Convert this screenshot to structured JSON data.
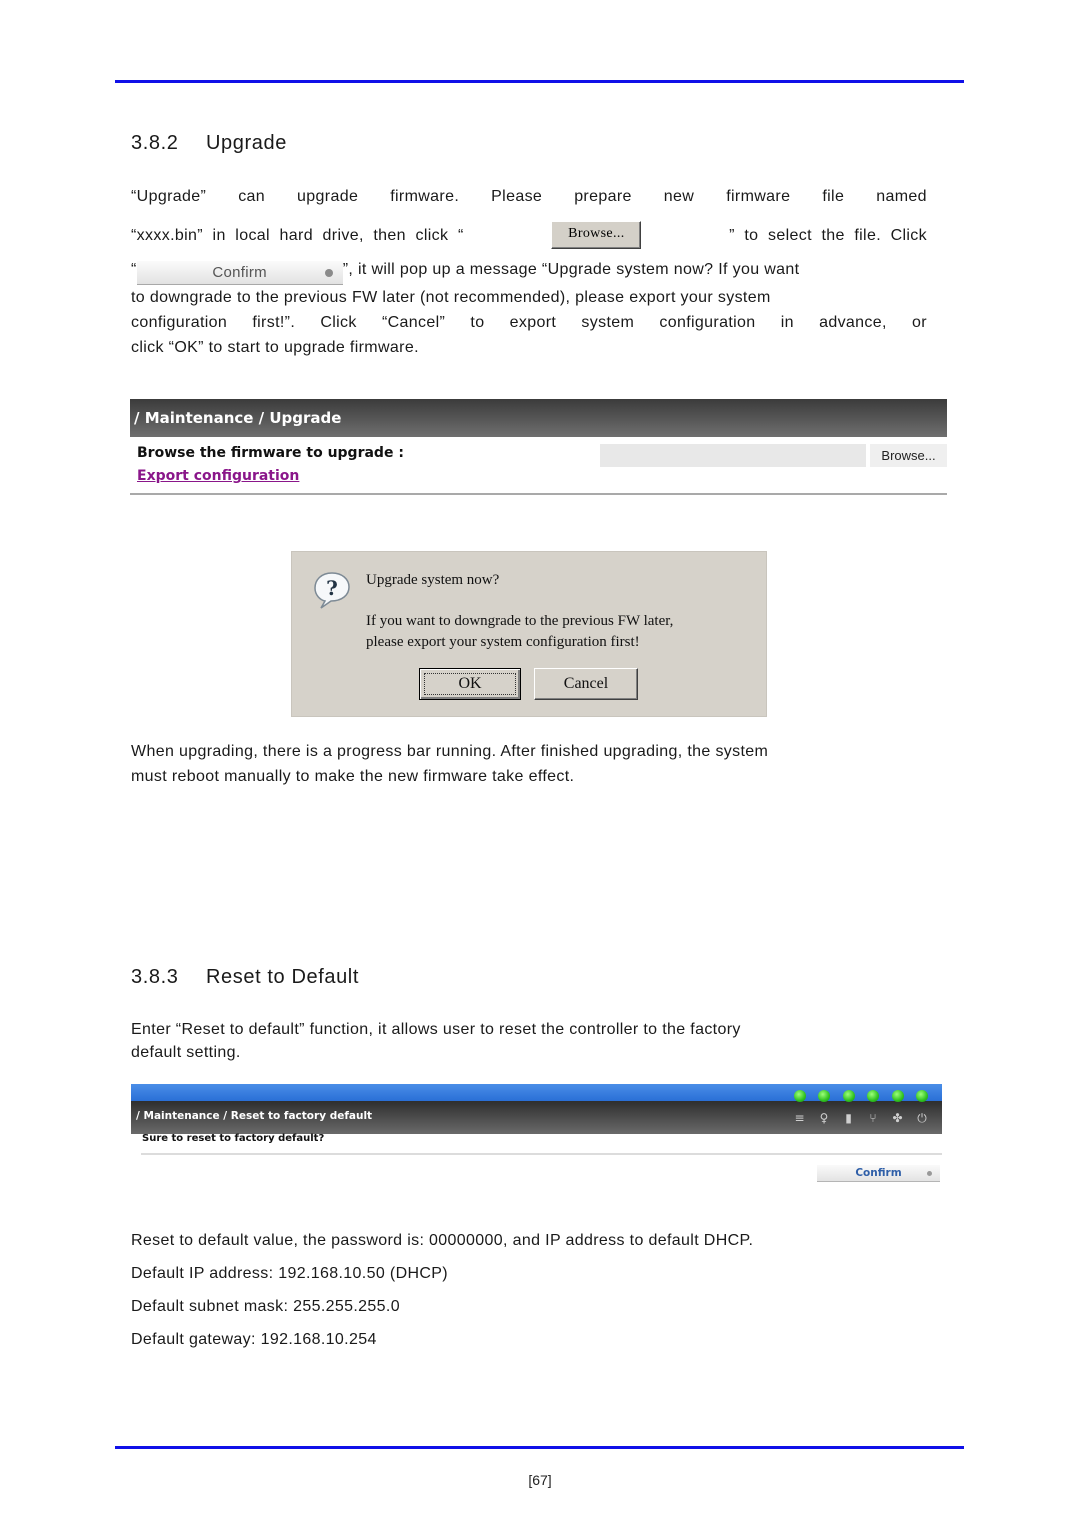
{
  "page": {
    "number": "[67]",
    "rule_color": "#1010e8"
  },
  "upgrade_section": {
    "number": "3.8.2",
    "title": "Upgrade",
    "intro": {
      "line1_words": [
        "“Upgrade”",
        "can",
        "upgrade",
        "firmware.",
        "Please",
        "prepare",
        "new",
        "firmware",
        "file",
        "named"
      ],
      "line2_before": "“xxxx.bin”  in  local  hard  drive,  then  click  “",
      "browse_label": "Browse...",
      "line2_after": "”  to  select  the  file.  Click",
      "line3_before": "“",
      "confirm_label": "Confirm",
      "line3_after": "”, it will pop up a message “Upgrade system now? If you want",
      "line4": "to downgrade to the previous FW later (not recommended), please export your system",
      "line5_words": [
        "configuration",
        "first!”.",
        "Click",
        "“Cancel”",
        "to",
        "export",
        "system",
        "configuration",
        "in",
        "advance,",
        "or"
      ],
      "line6": "click “OK” to start to upgrade firmware."
    },
    "web_panel": {
      "breadcrumb": "/ Maintenance / Upgrade",
      "browse_label": "Browse the firmware to upgrade :",
      "file_value": "",
      "browse_button": "Browse...",
      "export_link": "Export configuration"
    },
    "dialog": {
      "icon": "question-icon",
      "title": "Upgrade system now?",
      "message_line1": "If you want to downgrade to the previous FW later,",
      "message_line2": "please export your system configuration first!",
      "ok_label": "OK",
      "cancel_label": "Cancel"
    },
    "after_text": {
      "line1": "When upgrading, there is a progress bar running. After finished upgrading, the system",
      "line2": "must reboot manually to make the new firmware take effect."
    }
  },
  "reset_section": {
    "number": "3.8.3",
    "title": "Reset to Default",
    "intro_line1": "Enter “Reset to default” function, it allows user to reset the controller to the factory",
    "intro_line2": "default setting.",
    "web_panel": {
      "breadcrumb": "/ Maintenance / Reset to factory default",
      "question": "Sure to reset to factory default?",
      "confirm_button": "Confirm",
      "status_leds": [
        "green",
        "green",
        "green",
        "green",
        "green",
        "green"
      ],
      "status_icons": [
        "storage-icon",
        "temperature-icon",
        "device-icon",
        "power-plug-icon",
        "fan-icon",
        "power-icon"
      ],
      "status_glyphs": [
        "≡",
        "♀",
        "▮",
        "⑂",
        "✤",
        "⏻"
      ]
    },
    "defaults": {
      "line1": "Reset to default value, the password is: 00000000, and IP address to default DHCP.",
      "ip": "Default IP address: 192.168.10.50 (DHCP)",
      "subnet": "Default subnet mask: 255.255.255.0",
      "gateway": "Default gateway: 192.168.10.254"
    }
  }
}
